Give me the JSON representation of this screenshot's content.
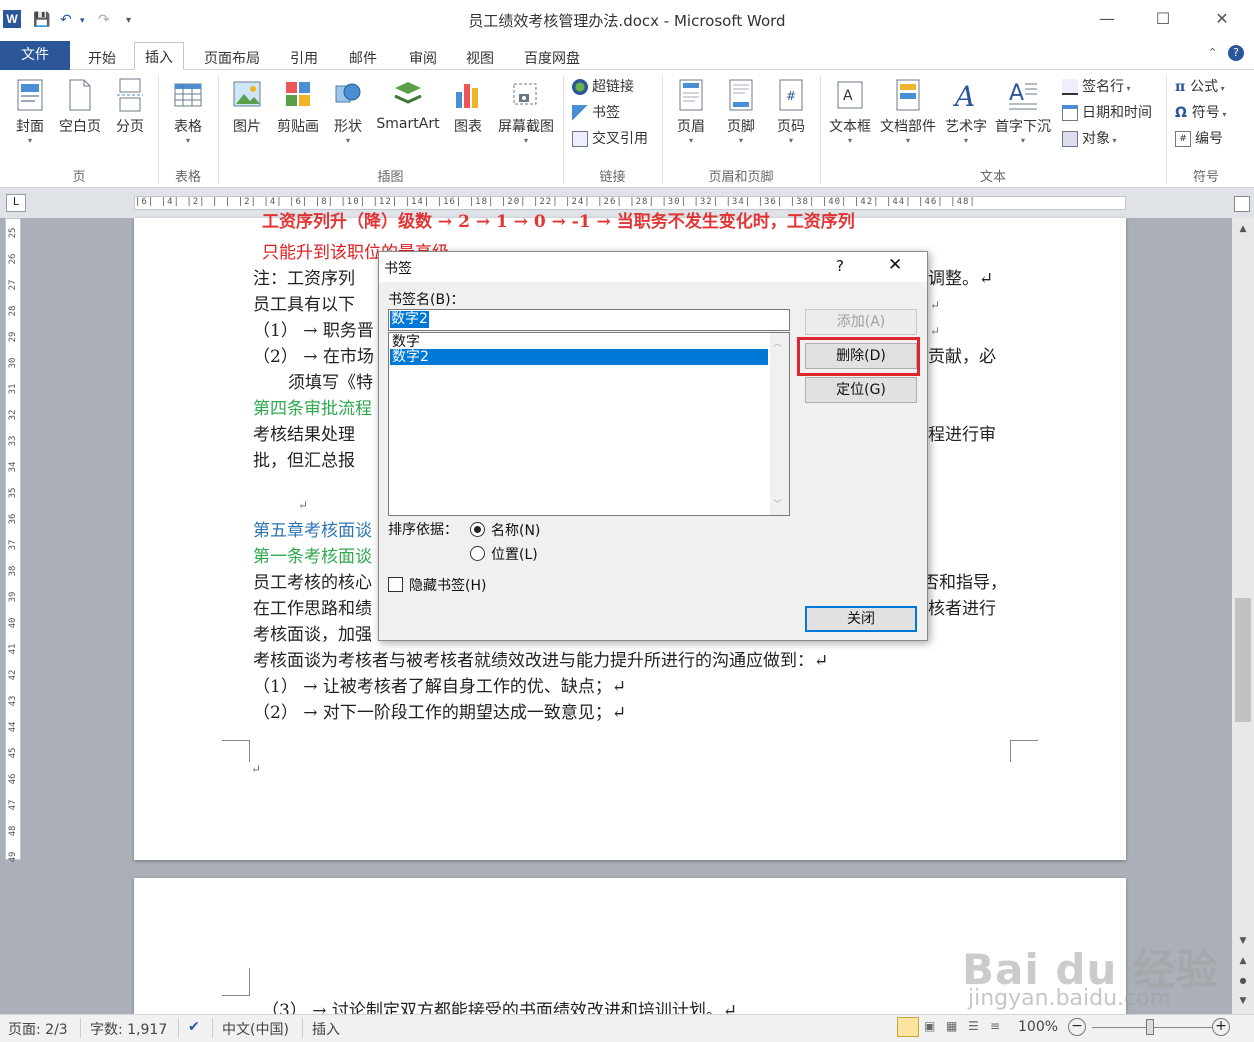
{
  "window": {
    "title": "员工绩效考核管理办法.docx - Microsoft Word",
    "app_icon": "W",
    "min": "—",
    "max": "☐",
    "close": "✕"
  },
  "quick_access": {
    "save": "💾",
    "undo": "↶",
    "redo": "↷",
    "more": "▾"
  },
  "tabs": [
    "文件",
    "开始",
    "插入",
    "页面布局",
    "引用",
    "邮件",
    "审阅",
    "视图",
    "百度网盘"
  ],
  "ribbon": {
    "groups": {
      "pages": "页",
      "table": "表格",
      "illustrations": "插图",
      "links": "链接",
      "header_footer": "页眉和页脚",
      "text": "文本",
      "symbols": "符号"
    },
    "buttons": {
      "cover": "封面",
      "blank": "空白页",
      "break": "分页",
      "table": "表格",
      "picture": "图片",
      "clipart": "剪贴画",
      "shapes": "形状",
      "smartart": "SmartArt",
      "chart": "图表",
      "screenshot": "屏幕截图",
      "hyperlink": "超链接",
      "bookmark": "书签",
      "crossref": "交叉引用",
      "header": "页眉",
      "footer": "页脚",
      "pagenum": "页码",
      "textbox": "文本框",
      "quickparts": "文档部件",
      "wordart": "艺术字",
      "dropcap": "首字下沉",
      "signature": "签名行",
      "datetime": "日期和时间",
      "object": "对象",
      "equation": "公式",
      "symbol": "符号",
      "number": "编号"
    }
  },
  "ruler": {
    "h_marks": "|6| |4| |2| |  | |2| |4| |6| |8| |10| |12| |14| |16| |18| |20| |22| |24| |26| |28| |30| |32| |34| |36| |38| |40| |42| |44| |46| |48|",
    "v_marks": [
      "25",
      "26",
      "27",
      "28",
      "29",
      "30",
      "31",
      "32",
      "33",
      "34",
      "35",
      "36",
      "37",
      "38",
      "39",
      "40",
      "41",
      "42",
      "43",
      "44",
      "45",
      "46",
      "47",
      "48",
      "49"
    ]
  },
  "document": {
    "lines": [
      "工资序列升（降）级数 → 2    →    1    →    0    →    -1   →   当职务不发生变化时，工资序列",
      "只能升到该职位的最高级",
      "注：工资序列",
      "员工具有以下",
      "（1） → 职务晋",
      "（2） → 在市场",
      "须填写《特",
      "第四条审批流程",
      "考核结果处理",
      "批，但汇总报",
      "↵",
      "第五章考核面谈",
      "第一条考核面谈",
      "员工考核的核心",
      "在工作思路和绩",
      "考核面谈，加强",
      "考核面谈为考核者与被考核者就绩效改进与能力提升所进行的沟通应做到：↵",
      "（1） → 让被考核者了解自身工作的优、缺点；↵",
      "（2） → 对下一阶段工作的期望达成一致意见；↵",
      "↵"
    ],
    "right_fragments": [
      "调整。↵",
      "↵",
      "↵",
      "贡献，必",
      "程进行审",
      "否和指导，",
      "核者进行"
    ],
    "page2_line": "（3） → 讨论制定双方都能接受的书面绩效改进和培训计划。↵"
  },
  "dialog": {
    "title": "书签",
    "help": "?",
    "close_x": "✕",
    "name_label": "书签名(B)：",
    "name_value": "数字2",
    "items": [
      "数字",
      "数字2"
    ],
    "selected_index": 1,
    "add": "添加(A)",
    "delete": "删除(D)",
    "goto": "定位(G)",
    "sort_label": "排序依据：",
    "sort_name": "名称(N)",
    "sort_location": "位置(L)",
    "hidden_label": "隐藏书签(H)",
    "close": "关闭"
  },
  "status": {
    "page": "页面: 2/3",
    "words": "字数: 1,917",
    "lang": "中文(中国)",
    "mode": "插入",
    "zoom": "100%"
  },
  "watermark": {
    "line1": "Bai du 经验",
    "line2": "jingyan.baidu.com"
  },
  "colors": {
    "accent": "#2b579a",
    "selection": "#0078d7",
    "highlight": "#e0242b",
    "red_text": "#e02020",
    "green_heading": "#2fa84f",
    "blue_heading": "#2e75b6"
  }
}
